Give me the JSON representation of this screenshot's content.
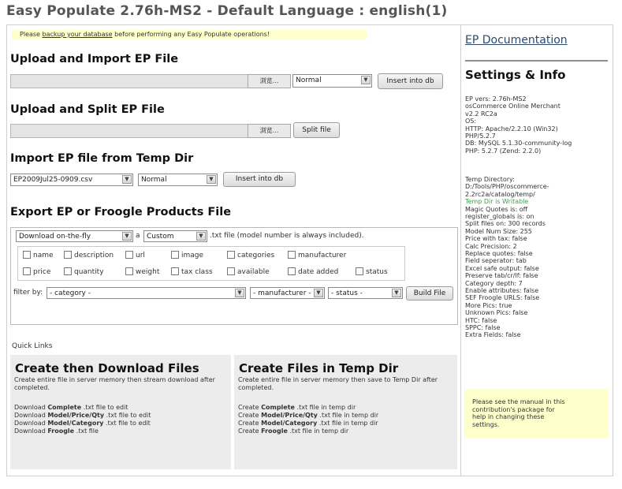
{
  "page": {
    "title": "Easy Populate 2.76h-MS2 - Default Language : english(1)"
  },
  "notice": {
    "prefix": "Please ",
    "link": "backup your database",
    "suffix": " before performing any Easy Populate operations!"
  },
  "upload_import": {
    "heading": "Upload and Import EP File",
    "browse_label": "浏览...",
    "mode_value": "Normal",
    "button": "Insert into db"
  },
  "upload_split": {
    "heading": "Upload and Split EP File",
    "browse_label": "浏览...",
    "button": "Split file"
  },
  "temp_import": {
    "heading": "Import EP file from Temp Dir",
    "file_value": "EP2009Jul25-0909.csv",
    "mode_value": "Normal",
    "button": "Insert into db"
  },
  "export": {
    "heading": "Export EP or Froogle Products File",
    "download_value": "Download on-the-fly",
    "a_text": "a",
    "type_value": "Custom",
    "suffix_text": ".txt file (model number is always included).",
    "checkboxes": [
      "name",
      "description",
      "url",
      "image",
      "categories",
      "manufacturer",
      "price",
      "quantity",
      "weight",
      "tax class",
      "available",
      "date added",
      "status"
    ],
    "filter_label": "filter by:",
    "category_value": "- category -",
    "manufacturer_value": "- manufacturer -",
    "status_value": "- status -",
    "build_button": "Build File"
  },
  "quick_links": {
    "label": "Quick Links",
    "left": {
      "title": "Create then Download Files",
      "desc": "Create entire file in server memory then stream download after completed.",
      "links": [
        {
          "pre": "Download ",
          "bold": "Complete",
          "post": " .txt file to edit"
        },
        {
          "pre": "Download ",
          "bold": "Model/Price/Qty",
          "post": " .txt file to edit"
        },
        {
          "pre": "Download ",
          "bold": "Model/Category",
          "post": " .txt file to edit"
        },
        {
          "pre": "Download ",
          "bold": "Froogle",
          "post": " .txt file"
        }
      ]
    },
    "right": {
      "title": "Create Files in Temp Dir",
      "desc": "Create entire file in server memory then save to Temp Dir after completed.",
      "links": [
        {
          "pre": "Create ",
          "bold": "Complete",
          "post": " .txt file in temp dir"
        },
        {
          "pre": "Create ",
          "bold": "Model/Price/Qty",
          "post": " .txt file in temp dir"
        },
        {
          "pre": "Create ",
          "bold": "Model/Category",
          "post": " .txt file in temp dir"
        },
        {
          "pre": "Create ",
          "bold": "Froogle",
          "post": " .txt file in temp dir"
        }
      ]
    }
  },
  "sidebar": {
    "doc_link": "EP Documentation",
    "settings_title": "Settings & Info",
    "info_lines_1": [
      "EP vers: 2.76h-MS2",
      "osCommerce Online Merchant",
      "v2.2 RC2a",
      "OS:",
      "HTTP: Apache/2.2.10 (Win32)",
      "PHP/5.2.7",
      "DB: MySQL 5.1.30-community-log",
      "PHP: 5.2.7 (Zend: 2.2.0)"
    ],
    "info_lines_2": [
      "Temp Directory:",
      "D:/Tools/PHP/oscommerce-",
      "2.2rc2a/catalog/temp/"
    ],
    "temp_status": "Temp Dir is Writable",
    "info_lines_3": [
      "Magic Quotes is: off",
      "register_globals is: on",
      "Split files on: 300 records",
      "Model Num Size: 255",
      "Price with tax: false",
      "Calc Precision: 2",
      "Replace quotes: false",
      "Field seperator: tab",
      "Excel safe output: false",
      "Preserve tab/cr/lf: false",
      "Category depth: 7",
      "Enable attributes: false",
      "SEF Froogle URLS: false",
      "More Pics: true",
      "Unknown Pics: false",
      "HTC: false",
      "SPPC: false",
      "Extra Fields: false"
    ],
    "manual_lines": [
      "Please see the manual in this",
      "contribution's package for",
      "help in changing these",
      "settings."
    ]
  }
}
